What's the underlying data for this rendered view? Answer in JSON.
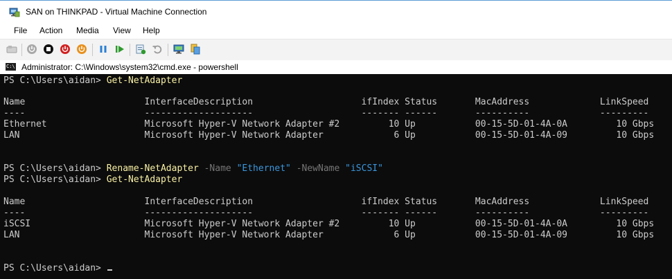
{
  "window": {
    "title": "SAN on THINKPAD - Virtual Machine Connection"
  },
  "menu": [
    "File",
    "Action",
    "Media",
    "View",
    "Help"
  ],
  "toolbar": {
    "icons": [
      "ctrl-alt-del-icon",
      "start-icon",
      "turn-off-icon",
      "shutdown-icon",
      "save-icon",
      "pause-icon",
      "resume-icon",
      "checkpoint-icon",
      "revert-icon",
      "enhanced-session-icon",
      "share-icon"
    ]
  },
  "console": {
    "title": "Administrator: C:\\Windows\\system32\\cmd.exe - powershell",
    "prompt": "PS C:\\Users\\aidan> ",
    "cmd1": "Get-NetAdapter",
    "rename": {
      "cmd": "Rename-NetAdapter",
      "p1": "-Name",
      "v1": "\"Ethernet\"",
      "p2": "-NewName",
      "v2": "\"iSCSI\""
    },
    "cmd3": "Get-NetAdapter",
    "header": "Name                      InterfaceDescription                    ifIndex Status       MacAddress             LinkSpeed",
    "underline": "----                      --------------------                    ------- ------       ----------             ---------",
    "table1": [
      "Ethernet                  Microsoft Hyper-V Network Adapter #2         10 Up           00-15-5D-01-4A-0A         10 Gbps",
      "LAN                       Microsoft Hyper-V Network Adapter             6 Up           00-15-5D-01-4A-09         10 Gbps"
    ],
    "table2": [
      "iSCSI                     Microsoft Hyper-V Network Adapter #2         10 Up           00-15-5D-01-4A-0A         10 Gbps",
      "LAN                       Microsoft Hyper-V Network Adapter             6 Up           00-15-5D-01-4A-09         10 Gbps"
    ]
  }
}
